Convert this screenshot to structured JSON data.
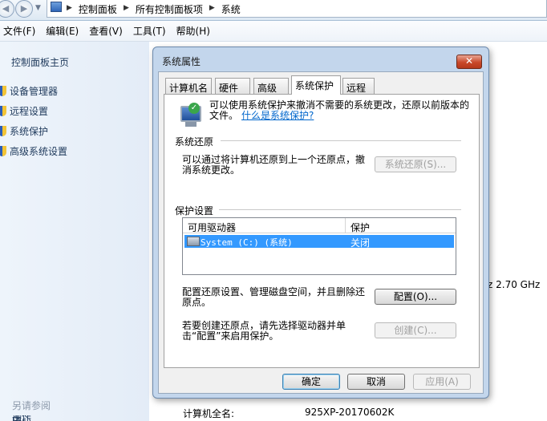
{
  "breadcrumb": [
    "控制面板",
    "所有控制面板项",
    "系统"
  ],
  "menu": [
    "文件(F)",
    "编辑(E)",
    "查看(V)",
    "工具(T)",
    "帮助(H)"
  ],
  "sidebar": {
    "home": "控制面板主页",
    "items": [
      {
        "label": "设备管理器",
        "icon": "shield-icon"
      },
      {
        "label": "远程设置",
        "icon": "shield-icon"
      },
      {
        "label": "系统保护",
        "icon": "shield-icon"
      },
      {
        "label": "高级系统设置",
        "icon": "shield-icon"
      }
    ],
    "see_also": "另请参阅"
  },
  "background": {
    "cpu_speed": "z  2.70 GHz",
    "computer_name_label": "计算机全名:",
    "computer_name_value": "925XP-20170602K"
  },
  "dialog": {
    "title": "系统属性",
    "close": "✕",
    "tabs": [
      "计算机名",
      "硬件",
      "高级",
      "系统保护",
      "远程"
    ],
    "active_tab": "系统保护",
    "intro_text": "可以使用系统保护来撤消不需要的系统更改，还原以前版本的文件。",
    "intro_link": "什么是系统保护?",
    "restore": {
      "group_title": "系统还原",
      "description": "可以通过将计算机还原到上一个还原点，撤消系统更改。",
      "button": "系统还原(S)..."
    },
    "protection": {
      "group_title": "保护设置",
      "columns": [
        "可用驱动器",
        "保护"
      ],
      "drives": [
        {
          "name": "System (C:) (系统)",
          "protection": "关闭",
          "selected": true
        }
      ],
      "configure_text": "配置还原设置、管理磁盘空间，并且删除还原点。",
      "configure_button": "配置(O)...",
      "create_text": "若要创建还原点，请先选择驱动器并单击“配置”来启用保护。",
      "create_button": "创建(C)..."
    },
    "buttons": {
      "ok": "确定",
      "cancel": "取消",
      "apply": "应用(A)"
    }
  },
  "colors": {
    "selection": "#3399ff",
    "link": "#0066cc",
    "close_button": "#c9492a",
    "sidebar_link": "#1e395b"
  }
}
